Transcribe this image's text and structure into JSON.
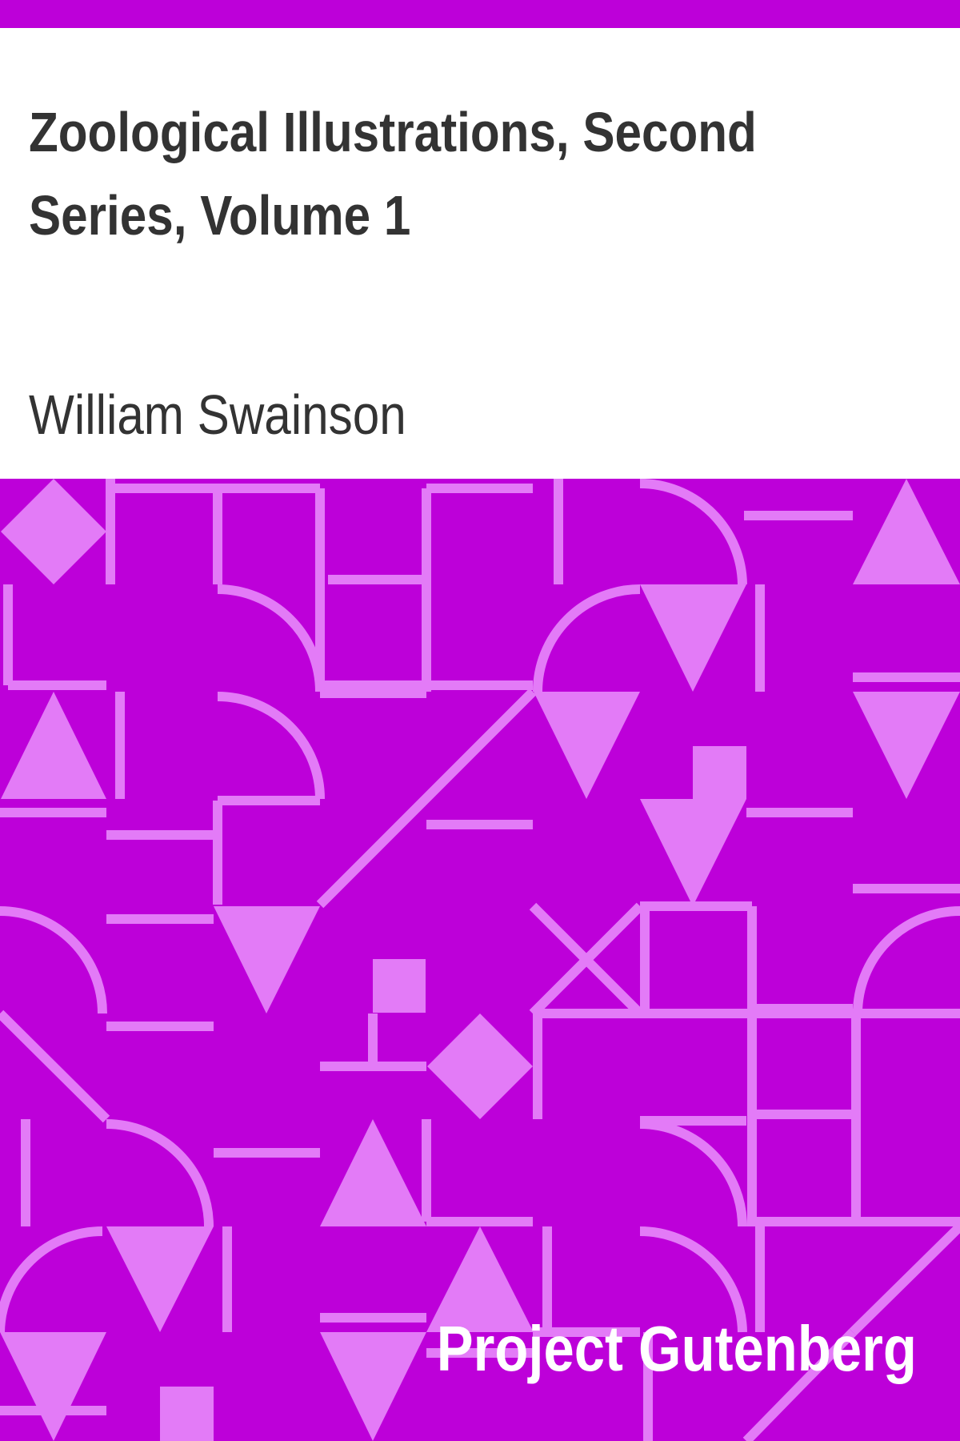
{
  "cover": {
    "title": "Zoological Illustrations, Second Series, Volume 1",
    "author": "William Swainson",
    "publisher": "Project Gutenberg"
  },
  "colors": {
    "accent": "#bd00d9",
    "pattern_light": "#e37bf7",
    "title_text": "#333333",
    "publisher_text": "#ffffff"
  }
}
